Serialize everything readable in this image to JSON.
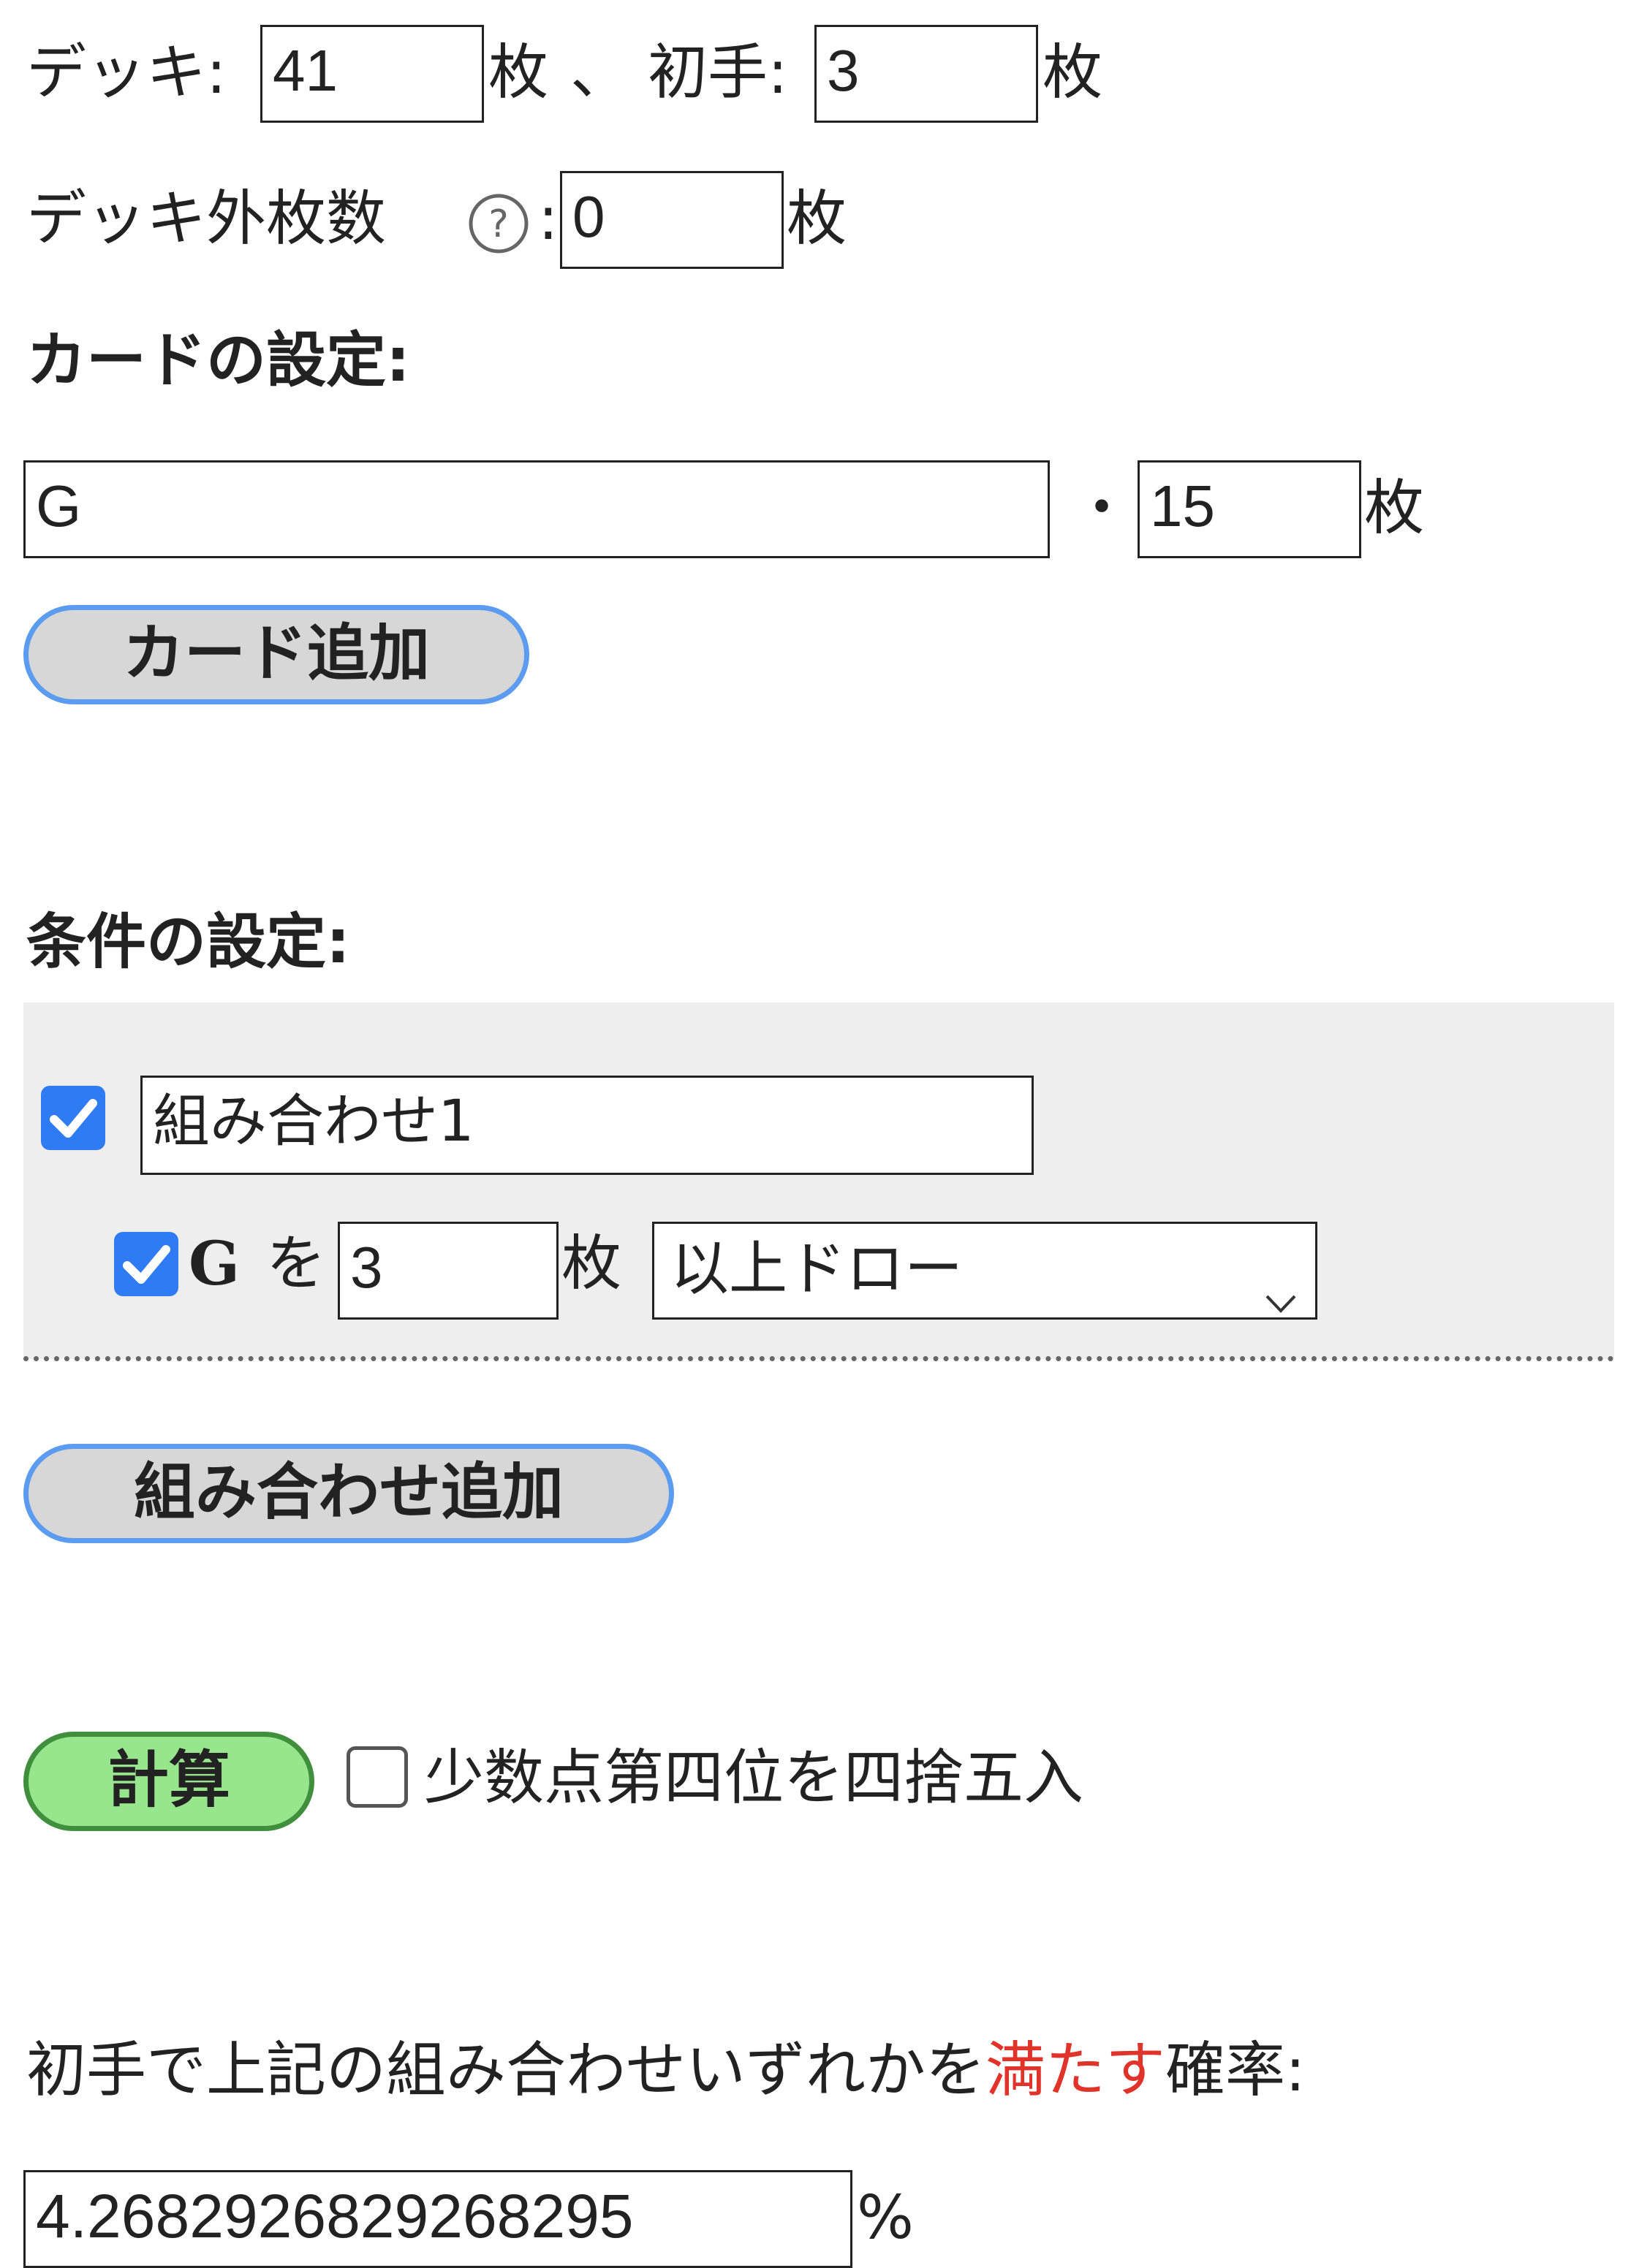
{
  "deck": {
    "label": "デッキ:",
    "count": "41",
    "unit": "枚",
    "separator": "、",
    "hand_label": "初手:",
    "hand_count": "3",
    "hand_unit": "枚"
  },
  "outside": {
    "label": "デッキ外枚数",
    "help_icon": "question-circle-icon",
    "colon": ":",
    "count": "0",
    "unit": "枚"
  },
  "card_settings": {
    "heading": "カードの設定:",
    "card_name": "G",
    "bullet": "・",
    "card_count": "15",
    "card_unit": "枚",
    "add_button": "カード追加"
  },
  "condition_settings": {
    "heading": "条件の設定:",
    "combo_checked": true,
    "combo_name": "組み合わせ1",
    "row": {
      "checked": true,
      "card": "G",
      "particle": "を",
      "count": "3",
      "unit": "枚",
      "mode": "以上ドロー"
    },
    "add_combo_button": "組み合わせ追加"
  },
  "calc": {
    "button": "計算",
    "round_checked": false,
    "round_label": "少数点第四位を四捨五入"
  },
  "result": {
    "label_prefix": "初手で上記の組み合わせいずれかを",
    "label_highlight": "満たす",
    "label_suffix": "確率:",
    "value": "4.2682926829268295",
    "unit": "%"
  },
  "colors": {
    "button_border": "#5b9cf0",
    "button_bg": "#d7d7d7",
    "calc_bg": "#97e68d",
    "calc_border": "#3f8f3c",
    "checkbox": "#2f7bf4",
    "highlight": "#e0342b"
  }
}
